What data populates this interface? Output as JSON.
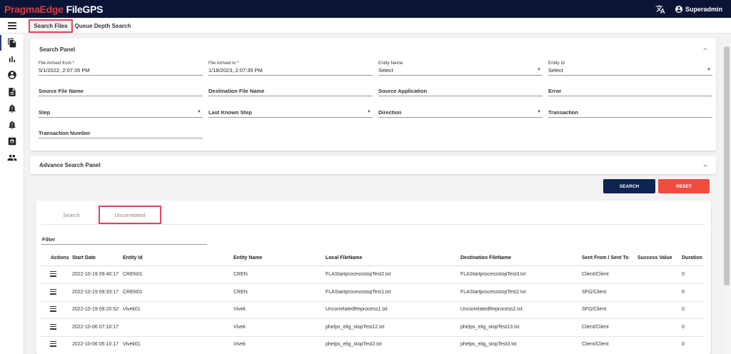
{
  "app": {
    "brand_red": "PragmaEdge",
    "brand_white": "FileGPS"
  },
  "user": {
    "name": "Superadmin"
  },
  "nav": {
    "tabs": [
      "Search Files",
      "Queue Depth Search"
    ]
  },
  "sidebar": {
    "icons": [
      "files-icon",
      "bar-chart-icon",
      "account-circle-icon",
      "document-icon",
      "bell-alert-icon",
      "bell-alert-2-icon",
      "dashboard-icon",
      "group-icon"
    ]
  },
  "search_panel": {
    "title": "Search Panel",
    "file_arrived_from": {
      "label": "File Arrived from *",
      "value": "5/1/2022, 2:07:35 PM"
    },
    "file_arrived_to": {
      "label": "File Arrived to *",
      "value": "1/18/2023, 2:07:35 PM"
    },
    "entity_name": {
      "label": "Entity Name",
      "value": "Select"
    },
    "entity_id": {
      "label": "Entity Id",
      "value": "Select"
    },
    "source_file_name": "Source File Name",
    "destination_file_name": "Destination File Name",
    "source_application": "Source Application",
    "error": "Error",
    "step": "Step",
    "last_known_step": "Last Known Step",
    "direction": "Direction",
    "transaction": "Transaction",
    "transaction_number": "Transaction Number"
  },
  "advance_panel": {
    "title": "Advance Search Panel"
  },
  "buttons": {
    "search": "SEARCH",
    "reset": "RESET"
  },
  "results": {
    "tabs": [
      "Search",
      "Uncorrelated"
    ],
    "filter_label": "Filter",
    "columns": [
      "Actions",
      "Start Date",
      "Entity Id",
      "Entity Name",
      "Local FileName",
      "Destination FileName",
      "Sent From / Sent To",
      "Success Value",
      "Duration"
    ],
    "rows": [
      {
        "start_date": "2022-10-19 09:40:17",
        "entity_id": "CREN01",
        "entity_name": "CREN",
        "local_file": "FLAStartprocessstopTest2.txt",
        "dest_file": "FLAStartprocessstopTest3.txt",
        "sent": "Client/Client",
        "success": "",
        "duration": "0"
      },
      {
        "start_date": "2022-10-19 09:33:17",
        "entity_id": "CREN01",
        "entity_name": "CREN",
        "local_file": "FLAStartprocessstopTest1.txt",
        "dest_file": "FLAStartprocessstopTest2.txt",
        "sent": "SFG/Client",
        "success": "",
        "duration": "0"
      },
      {
        "start_date": "2022-10-19 09:20:52",
        "entity_id": "Vivek01",
        "entity_name": "Vivek",
        "local_file": "UncorrelatedReprocess1.txt",
        "dest_file": "UncorrelatedReprocess2.txt",
        "sent": "SFG/Client",
        "success": "",
        "duration": "0"
      },
      {
        "start_date": "2022-10-06 07:10:17",
        "entity_id": "",
        "entity_name": "Vivek",
        "local_file": "phelps_elig_stopTest12.txt",
        "dest_file": "phelps_elig_stopTest13.txt",
        "sent": "Client/Client",
        "success": "",
        "duration": "0"
      },
      {
        "start_date": "2022-10-06 05:10:17",
        "entity_id": "Vivek01",
        "entity_name": "Vivek",
        "local_file": "phelps_elig_stopTest2.txt",
        "dest_file": "phelps_elig_stopTest3.txt",
        "sent": "Client/Client",
        "success": "",
        "duration": "0"
      }
    ]
  }
}
